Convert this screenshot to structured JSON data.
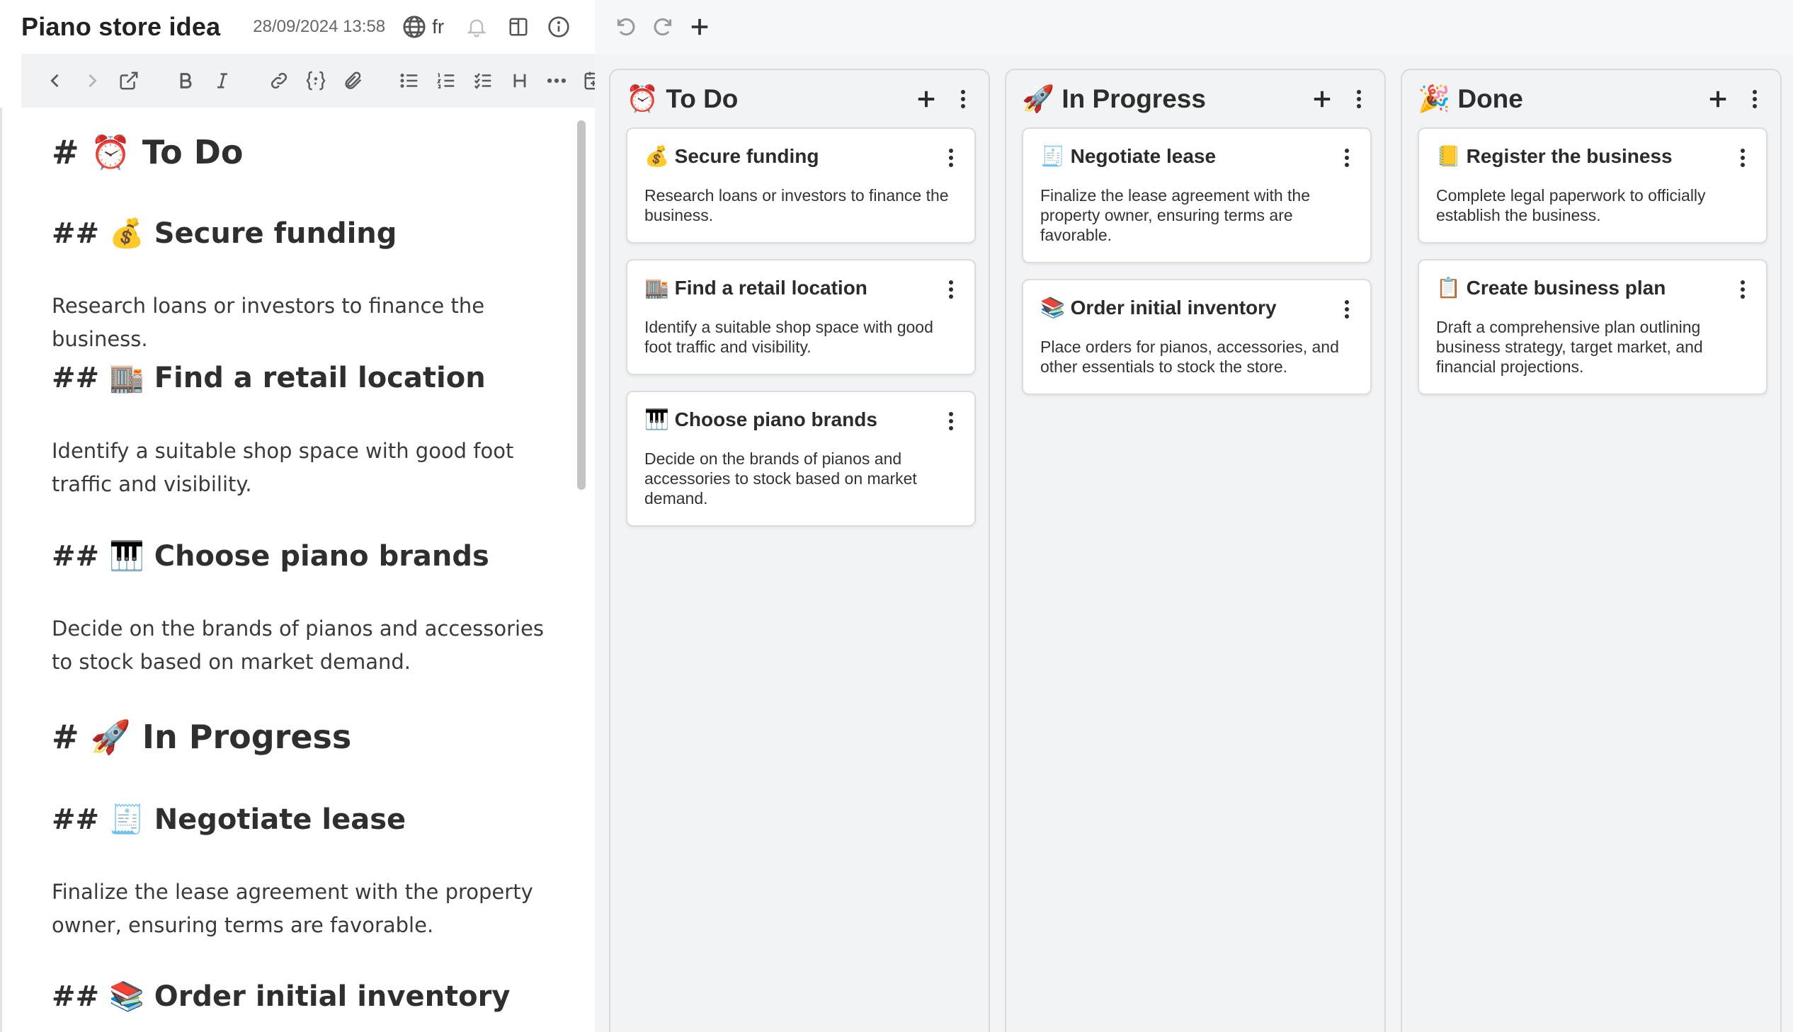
{
  "app": {
    "title": "Piano store idea",
    "date": "28/09/2024 13:58",
    "language": "fr"
  },
  "editor": {
    "blocks": [
      {
        "kind": "h1",
        "text": "# ⏰ To Do"
      },
      {
        "kind": "h2",
        "text": "## 💰 Secure funding"
      },
      {
        "kind": "p",
        "text": "Research loans or investors to finance the business."
      },
      {
        "kind": "h2",
        "text": "## 🏬 Find a retail location"
      },
      {
        "kind": "p",
        "text": "Identify a suitable shop space with good foot traffic and visibility."
      },
      {
        "kind": "h2",
        "text": "## 🎹 Choose piano brands"
      },
      {
        "kind": "p",
        "text": "Decide on the brands of pianos and accessories to stock based on market demand."
      },
      {
        "kind": "h1",
        "text": "# 🚀 In Progress"
      },
      {
        "kind": "h2",
        "text": "## 🧾 Negotiate lease"
      },
      {
        "kind": "p",
        "text": "Finalize the lease agreement with the property owner, ensuring terms are favorable."
      },
      {
        "kind": "h2",
        "text": "## 📚 Order initial inventory"
      }
    ]
  },
  "board": {
    "columns": [
      {
        "title": "⏰ To Do",
        "cards": [
          {
            "title": "💰 Secure funding",
            "desc": "Research loans or investors to finance the business."
          },
          {
            "title": "🏬 Find a retail location",
            "desc": "Identify a suitable shop space with good foot traffic and visibility."
          },
          {
            "title": "🎹 Choose piano brands",
            "desc": "Decide on the brands of pianos and accessories to stock based on market demand."
          }
        ]
      },
      {
        "title": "🚀 In Progress",
        "cards": [
          {
            "title": "🧾 Negotiate lease",
            "desc": "Finalize the lease agreement with the property owner, ensuring terms are favorable."
          },
          {
            "title": "📚 Order initial inventory",
            "desc": "Place orders for pianos, accessories, and other essentials to stock the store."
          }
        ]
      },
      {
        "title": "🎉 Done",
        "cards": [
          {
            "title": "📒 Register the business",
            "desc": "Complete legal paperwork to officially establish the business."
          },
          {
            "title": "📋 Create business plan",
            "desc": "Draft a comprehensive plan outlining business strategy, target market, and financial projections."
          }
        ]
      }
    ]
  },
  "icons": {
    "titlebar": [
      "globe-icon",
      "bell-icon",
      "split-view-icon",
      "info-icon"
    ],
    "format_toolbar": [
      "back-icon",
      "forward-icon",
      "open-external-icon",
      "bold-icon",
      "italic-icon",
      "link-icon",
      "code-block-icon",
      "attachment-icon",
      "bullet-list-icon",
      "numbered-list-icon",
      "checklist-icon",
      "heading-icon",
      "more-icon",
      "insert-date-icon"
    ],
    "board_toolbar": [
      "undo-icon",
      "redo-icon",
      "add-icon"
    ]
  },
  "colors": {
    "board_bg": "#f3f4f5",
    "column_border": "#d9dadb",
    "toolbar_bg": "#f1f2f3",
    "icon": "#5a5a5a",
    "text": "#2b2b2b"
  }
}
